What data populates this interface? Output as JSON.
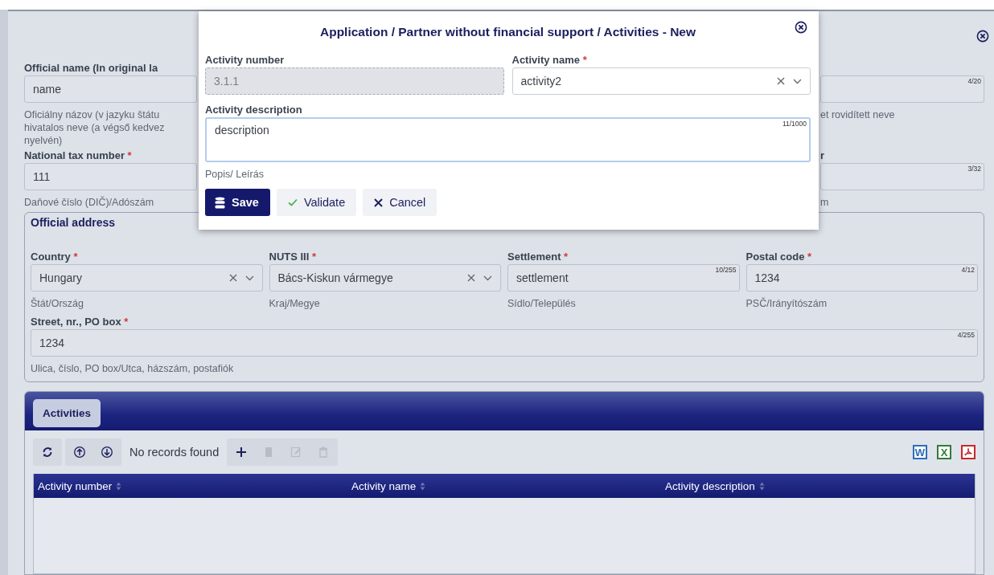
{
  "page": {
    "top_fields": [
      {
        "label": "Official name (In original la",
        "value": "name",
        "hint_lines": [
          "Oficiálny názov (v jazyku štátu",
          "hivatalos neve (a végső kedvez",
          "nyelvén)"
        ]
      },
      {
        "counter": "4/20",
        "hint_lines": [
          "et rovidített neve"
        ]
      },
      {
        "label": "National tax number",
        "required_mark": "*",
        "value": "111",
        "hint_lines": [
          "Daňové číslo (DIČ)/Adószám"
        ]
      },
      {
        "label": "r",
        "counter": "3/32",
        "hint_lines": [
          "m"
        ]
      }
    ],
    "official_address": {
      "title": "Official address",
      "fields": [
        {
          "label": "Country",
          "required_mark": "*",
          "kind": "select",
          "value": "Hungary",
          "hint_lines": [
            "Štát/Ország"
          ]
        },
        {
          "label": "NUTS III",
          "required_mark": "*",
          "kind": "select",
          "value": "Bács-Kiskun vármegye",
          "hint_lines": [
            "Kraj/Megye"
          ]
        },
        {
          "label": "Settlement",
          "required_mark": "*",
          "value": "settlement",
          "counter": "10/255",
          "hint_lines": [
            "Sídlo/Település"
          ]
        },
        {
          "label": "Postal code",
          "required_mark": "*",
          "value": "1234",
          "counter": "4/12",
          "hint_lines": [
            "PSČ/Irányítószám"
          ]
        },
        {
          "label": "Street, nr., PO box",
          "required_mark": "*",
          "value": "1234",
          "counter": "4/255",
          "hint_lines": [
            "Ulica, číslo, PO box/Utca, házszám, postafiók"
          ]
        }
      ]
    },
    "activities": {
      "tabs": [
        {
          "label": "Activities",
          "selected": true
        }
      ],
      "toolbar": [
        {
          "kind": "refresh",
          "disabled": false
        },
        {
          "kind": "move-up",
          "disabled": false
        },
        {
          "kind": "move-down",
          "disabled": false
        },
        {
          "kind": "add",
          "disabled": false
        },
        {
          "kind": "copy",
          "disabled": true
        },
        {
          "kind": "edit",
          "disabled": true
        },
        {
          "kind": "delete",
          "disabled": true
        }
      ],
      "status": "No records found",
      "exports": [
        {
          "kind": "word",
          "label": "W",
          "color": "#2d6fb7"
        },
        {
          "kind": "excel",
          "label": "X",
          "color": "#2e7d32"
        },
        {
          "kind": "pdf",
          "color": "#c62828"
        }
      ],
      "columns": [
        "Activity number",
        "Activity name",
        "Activity description"
      ]
    }
  },
  "dialog": {
    "title": "Application / Partner without financial support / Activities - New",
    "fields": [
      {
        "label": "Activity number",
        "kind": "readonly",
        "value": "3.1.1"
      },
      {
        "label": "Activity name",
        "required_mark": "*",
        "kind": "select",
        "value": "activity2"
      },
      {
        "label": "Activity description",
        "kind": "textarea",
        "value": "description",
        "counter": "11/1000",
        "hint_lines": [
          "Popis/ Leírás"
        ]
      }
    ],
    "buttons": [
      {
        "kind": "save",
        "label": "Save"
      },
      {
        "kind": "validate",
        "label": "Validate"
      },
      {
        "kind": "cancel",
        "label": "Cancel"
      }
    ]
  }
}
